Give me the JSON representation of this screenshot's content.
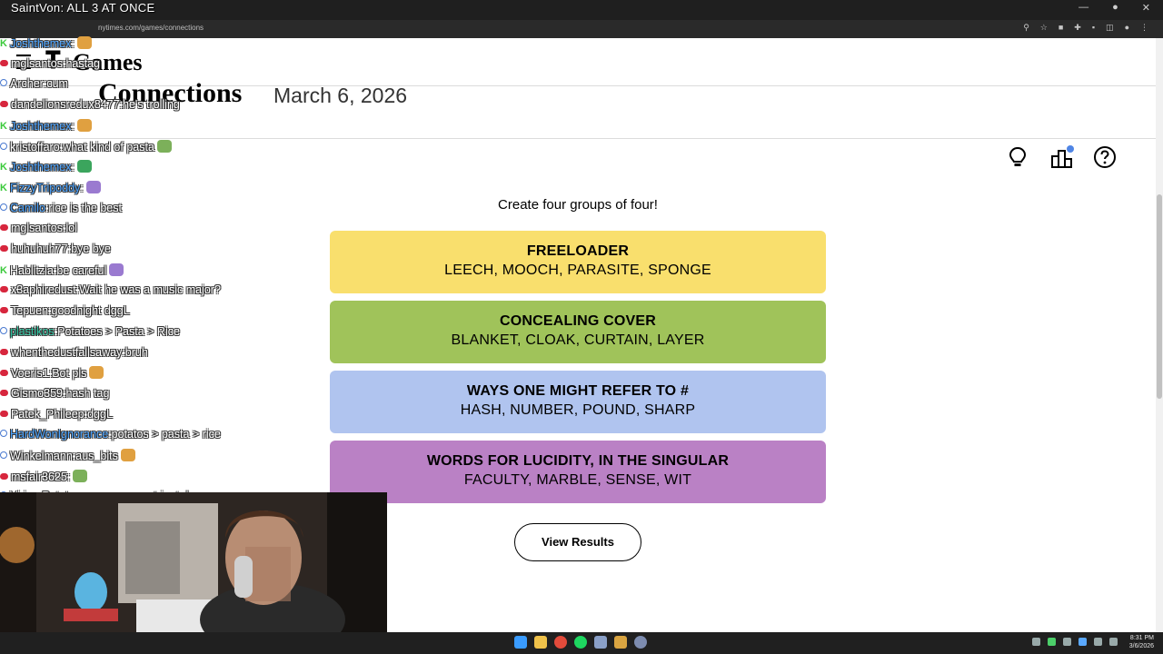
{
  "stream_title": "SaintVon: ALL 3 AT ONCE",
  "browser": {
    "url": "nytimes.com/games/connections"
  },
  "header": {
    "menu_icon": "hamburger-menu-icon",
    "logo_text": "Games"
  },
  "game": {
    "name": "Connections",
    "date": "March 6, 2026",
    "instructions": "Create four groups of four!",
    "tools": [
      "hint-lightbulb-icon",
      "stats-icon",
      "help-icon"
    ],
    "groups": [
      {
        "title": "FREELOADER",
        "words": "LEECH, MOOCH, PARASITE, SPONGE",
        "color": "#f9df6d"
      },
      {
        "title": "CONCEALING COVER",
        "words": "BLANKET, CLOAK, CURTAIN, LAYER",
        "color": "#a0c35a"
      },
      {
        "title": "WAYS ONE MIGHT REFER TO #",
        "words": "HASH, NUMBER, POUND, SHARP",
        "color": "#b0c4ef"
      },
      {
        "title": "WORDS FOR LUCIDITY, IN THE SINGULAR",
        "words": "FACULTY, MARBLE, SENSE, WIT",
        "color": "#ba81c5"
      }
    ],
    "view_results_label": "View Results"
  },
  "chat": [
    {
      "badge": "green",
      "user": "Joshthemex",
      "user_color": "#4aa3ff",
      "sep": ":",
      "text": ""
    },
    {
      "badge": "red",
      "user": "mglsantos",
      "user_color": "#ffffff",
      "sep": ":",
      "text": "hastag"
    },
    {
      "badge": "blue",
      "user": "Archer",
      "user_color": "#ffffff",
      "sep": ":",
      "text": "cum"
    },
    {
      "badge": "red",
      "user": "dandelionsredux8477",
      "user_color": "#ffffff",
      "sep": ":",
      "text": "he's trolling"
    },
    {
      "badge": "green",
      "user": "Joshthemex",
      "user_color": "#4aa3ff",
      "sep": ":",
      "text": ""
    },
    {
      "badge": "blue",
      "user": "kristoffaro",
      "user_color": "#ffffff",
      "sep": ":",
      "text": "what kind of pasta"
    },
    {
      "badge": "green",
      "user": "Joshthemex",
      "user_color": "#4aa3ff",
      "sep": ":",
      "text": ""
    },
    {
      "badge": "green",
      "user": "FizzyTripoddy",
      "user_color": "#4aa3ff",
      "sep": ":",
      "text": ""
    },
    {
      "badge": "blue",
      "user": "Camilo",
      "user_color": "#4aa3ff",
      "sep": ":",
      "text": "rice is the best"
    },
    {
      "badge": "red",
      "user": "mglsantos",
      "user_color": "#ffffff",
      "sep": ":",
      "text": "lol"
    },
    {
      "badge": "red",
      "user": "huhuhuh77",
      "user_color": "#ffffff",
      "sep": ":",
      "text": "bye bye"
    },
    {
      "badge": "green",
      "user": "Hablitzia",
      "user_color": "#ffffff",
      "sep": ":",
      "text": "be careful"
    },
    {
      "badge": "red",
      "user": "x3aphiredust",
      "user_color": "#ffffff",
      "sep": ":",
      "text": "Wait he was a music major?"
    },
    {
      "badge": "red",
      "user": "Tepuen",
      "user_color": "#ffffff",
      "sep": ":",
      "text": "goodnight dggL"
    },
    {
      "badge": "blue",
      "user": "plastikos",
      "user_color": "#2ec4a0",
      "sep": ":",
      "text": "Potatoes > Pasta > Rice"
    },
    {
      "badge": "red",
      "user": "whenthedustfallsaway",
      "user_color": "#ffffff",
      "sep": ":",
      "text": "bruh"
    },
    {
      "badge": "red",
      "user": "Voeris1",
      "user_color": "#ffffff",
      "sep": ":",
      "text": "Bot pls"
    },
    {
      "badge": "red",
      "user": "Gismo359",
      "user_color": "#ffffff",
      "sep": ":",
      "text": "hash tag"
    },
    {
      "badge": "red",
      "user": "Patek_Phileep",
      "user_color": "#ffffff",
      "sep": ":",
      "text": "dggL"
    },
    {
      "badge": "blue",
      "user": "HardWonIgnorance",
      "user_color": "#4aa3ff",
      "sep": ":",
      "text": "potatos > pasta > rice"
    },
    {
      "badge": "blue",
      "user": "Winkelmann",
      "user_color": "#ffffff",
      "sep": ":",
      "text": "aus_bits"
    },
    {
      "badge": "red",
      "user": "msfair3625",
      "user_color": "#ffffff",
      "sep": ":",
      "text": ""
    },
    {
      "badge": "blue",
      "user": "Virion",
      "user_color": "#ffffff",
      "sep": ":",
      "text": "Potatoes are super nutrient dense"
    }
  ],
  "clock": {
    "time": "8:31 PM",
    "date": "3/6/2026"
  },
  "colors": {
    "yellow": "#f9df6d",
    "green": "#a0c35a",
    "blue": "#b0c4ef",
    "purple": "#ba81c5"
  }
}
